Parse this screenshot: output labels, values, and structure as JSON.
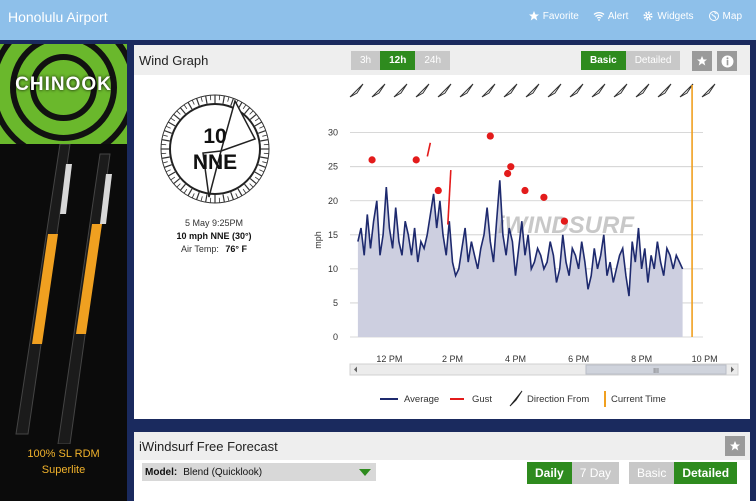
{
  "header": {
    "title": "Honolulu Airport",
    "nav": [
      {
        "label": "Favorite",
        "icon": "star-icon"
      },
      {
        "label": "Alert",
        "icon": "wifi-icon"
      },
      {
        "label": "Widgets",
        "icon": "gear-icon"
      },
      {
        "label": "Map",
        "icon": "globe-icon"
      }
    ]
  },
  "ad": {
    "brand": "CHINOOK",
    "caption_line1": "100% SL RDM",
    "caption_line2": "Superlite"
  },
  "wind_graph": {
    "title": "Wind Graph",
    "range_buttons": [
      "3h",
      "12h",
      "24h"
    ],
    "range_selected": "12h",
    "view_buttons": [
      "Basic",
      "Detailed"
    ],
    "view_selected": "Basic",
    "compass": {
      "speed": "10",
      "direction": "NNE"
    },
    "time": "5 May 9:25PM",
    "reading": "10 mph NNE (30°)",
    "air_temp_label": "Air Temp:",
    "air_temp_value": "76° F",
    "watermark": "iWINDSURF",
    "scrollbar_grip": "III"
  },
  "chart_data": {
    "type": "area",
    "ylabel": "mph",
    "ylim": [
      0,
      32
    ],
    "yticks": [
      0,
      5,
      10,
      15,
      20,
      25,
      30
    ],
    "x_tick_labels": [
      "12 PM",
      "2 PM",
      "4 PM",
      "6 PM",
      "8 PM",
      "10 PM"
    ],
    "x_range_hours": [
      10.75,
      22.2
    ],
    "current_time_hour": 21.6,
    "series": [
      {
        "name": "Average",
        "x": [
          11.0,
          11.1,
          11.2,
          11.3,
          11.4,
          11.5,
          11.6,
          11.7,
          11.8,
          11.9,
          12.0,
          12.1,
          12.2,
          12.3,
          12.4,
          12.5,
          12.6,
          12.7,
          12.8,
          12.9,
          13.0,
          13.1,
          13.2,
          13.3,
          13.4,
          13.5,
          13.6,
          13.7,
          13.8,
          13.9,
          14.0,
          14.1,
          14.2,
          14.3,
          14.4,
          14.5,
          14.6,
          14.7,
          14.8,
          14.9,
          15.0,
          15.1,
          15.2,
          15.3,
          15.4,
          15.5,
          15.6,
          15.7,
          15.8,
          15.9,
          16.0,
          16.1,
          16.2,
          16.3,
          16.4,
          16.5,
          16.6,
          16.7,
          16.8,
          16.9,
          17.0,
          17.1,
          17.2,
          17.3,
          17.4,
          17.5,
          17.6,
          17.7,
          17.8,
          17.9,
          18.0,
          18.1,
          18.2,
          18.3,
          18.4,
          18.5,
          18.6,
          18.7,
          18.8,
          18.9,
          19.0,
          19.1,
          19.2,
          19.3,
          19.4,
          19.5,
          19.6,
          19.7,
          19.8,
          19.9,
          20.0,
          20.1,
          20.2,
          20.3,
          20.4,
          20.5,
          20.6,
          20.7,
          20.8,
          20.9,
          21.0,
          21.1,
          21.2,
          21.3
        ],
        "values": [
          14,
          16,
          12,
          18,
          13,
          17,
          20,
          12,
          15,
          22,
          16,
          13,
          19,
          14,
          12,
          17,
          15,
          12,
          16,
          11,
          14,
          13,
          15,
          18,
          21,
          16,
          20,
          15,
          12,
          17,
          11,
          9,
          10,
          13,
          16,
          11,
          14,
          12,
          10,
          13,
          15,
          19,
          14,
          11,
          17,
          23,
          15,
          12,
          16,
          14,
          9,
          13,
          17,
          12,
          15,
          10,
          11,
          13,
          12,
          10,
          11,
          14,
          12,
          8,
          10,
          15,
          11,
          9,
          13,
          12,
          10,
          14,
          11,
          7,
          9,
          13,
          10,
          12,
          15,
          9,
          11,
          8,
          10,
          12,
          13,
          9,
          6,
          14,
          11,
          16,
          10,
          13,
          8,
          12,
          10,
          14,
          11,
          9,
          13,
          12,
          10,
          12,
          11,
          10
        ]
      },
      {
        "name": "Gust",
        "markers": [
          {
            "x": 11.45,
            "y": 26
          },
          {
            "x": 12.85,
            "y": 26
          },
          {
            "x": 13.55,
            "y": 21.5
          },
          {
            "x": 15.2,
            "y": 29.5
          },
          {
            "x": 15.75,
            "y": 24
          },
          {
            "x": 15.85,
            "y": 25
          },
          {
            "x": 16.3,
            "y": 21.5
          },
          {
            "x": 16.9,
            "y": 20.5
          },
          {
            "x": 17.55,
            "y": 17
          }
        ],
        "spikes": [
          {
            "x": 13.25,
            "y_low": 26.5,
            "y_high": 28.5
          },
          {
            "x": 13.9,
            "y_low": 16.5,
            "y_high": 24.5
          }
        ]
      }
    ],
    "direction_arrows": 17,
    "legend": [
      "Average",
      "Gust",
      "Direction From",
      "Current Time"
    ],
    "legend_position": "bottom",
    "colors": {
      "average": "#1e2a6e",
      "area": "#cdcfe0",
      "gust": "#e31b1b",
      "current_time": "#f0a020",
      "grid": "#cccccc"
    }
  },
  "forecast": {
    "title": "iWindsurf Free Forecast",
    "model_label": "Model:",
    "model_value": "Blend (Quicklook)",
    "mode_buttons": [
      "Daily",
      "7 Day"
    ],
    "mode_selected": "Daily",
    "view_buttons": [
      "Basic",
      "Detailed"
    ],
    "view_selected": "Detailed"
  }
}
